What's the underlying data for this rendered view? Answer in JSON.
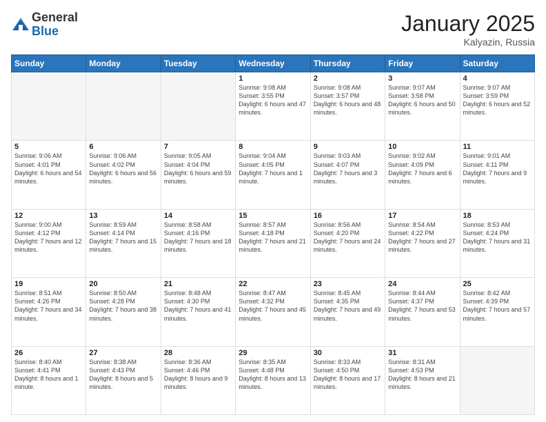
{
  "logo": {
    "general": "General",
    "blue": "Blue"
  },
  "header": {
    "month": "January 2025",
    "location": "Kalyazin, Russia"
  },
  "weekdays": [
    "Sunday",
    "Monday",
    "Tuesday",
    "Wednesday",
    "Thursday",
    "Friday",
    "Saturday"
  ],
  "weeks": [
    [
      {
        "day": "",
        "info": ""
      },
      {
        "day": "",
        "info": ""
      },
      {
        "day": "",
        "info": ""
      },
      {
        "day": "1",
        "info": "Sunrise: 9:08 AM\nSunset: 3:55 PM\nDaylight: 6 hours and 47 minutes."
      },
      {
        "day": "2",
        "info": "Sunrise: 9:08 AM\nSunset: 3:57 PM\nDaylight: 6 hours and 48 minutes."
      },
      {
        "day": "3",
        "info": "Sunrise: 9:07 AM\nSunset: 3:58 PM\nDaylight: 6 hours and 50 minutes."
      },
      {
        "day": "4",
        "info": "Sunrise: 9:07 AM\nSunset: 3:59 PM\nDaylight: 6 hours and 52 minutes."
      }
    ],
    [
      {
        "day": "5",
        "info": "Sunrise: 9:06 AM\nSunset: 4:01 PM\nDaylight: 6 hours and 54 minutes."
      },
      {
        "day": "6",
        "info": "Sunrise: 9:06 AM\nSunset: 4:02 PM\nDaylight: 6 hours and 56 minutes."
      },
      {
        "day": "7",
        "info": "Sunrise: 9:05 AM\nSunset: 4:04 PM\nDaylight: 6 hours and 59 minutes."
      },
      {
        "day": "8",
        "info": "Sunrise: 9:04 AM\nSunset: 4:05 PM\nDaylight: 7 hours and 1 minute."
      },
      {
        "day": "9",
        "info": "Sunrise: 9:03 AM\nSunset: 4:07 PM\nDaylight: 7 hours and 3 minutes."
      },
      {
        "day": "10",
        "info": "Sunrise: 9:02 AM\nSunset: 4:09 PM\nDaylight: 7 hours and 6 minutes."
      },
      {
        "day": "11",
        "info": "Sunrise: 9:01 AM\nSunset: 4:11 PM\nDaylight: 7 hours and 9 minutes."
      }
    ],
    [
      {
        "day": "12",
        "info": "Sunrise: 9:00 AM\nSunset: 4:12 PM\nDaylight: 7 hours and 12 minutes."
      },
      {
        "day": "13",
        "info": "Sunrise: 8:59 AM\nSunset: 4:14 PM\nDaylight: 7 hours and 15 minutes."
      },
      {
        "day": "14",
        "info": "Sunrise: 8:58 AM\nSunset: 4:16 PM\nDaylight: 7 hours and 18 minutes."
      },
      {
        "day": "15",
        "info": "Sunrise: 8:57 AM\nSunset: 4:18 PM\nDaylight: 7 hours and 21 minutes."
      },
      {
        "day": "16",
        "info": "Sunrise: 8:56 AM\nSunset: 4:20 PM\nDaylight: 7 hours and 24 minutes."
      },
      {
        "day": "17",
        "info": "Sunrise: 8:54 AM\nSunset: 4:22 PM\nDaylight: 7 hours and 27 minutes."
      },
      {
        "day": "18",
        "info": "Sunrise: 8:53 AM\nSunset: 4:24 PM\nDaylight: 7 hours and 31 minutes."
      }
    ],
    [
      {
        "day": "19",
        "info": "Sunrise: 8:51 AM\nSunset: 4:26 PM\nDaylight: 7 hours and 34 minutes."
      },
      {
        "day": "20",
        "info": "Sunrise: 8:50 AM\nSunset: 4:28 PM\nDaylight: 7 hours and 38 minutes."
      },
      {
        "day": "21",
        "info": "Sunrise: 8:48 AM\nSunset: 4:30 PM\nDaylight: 7 hours and 41 minutes."
      },
      {
        "day": "22",
        "info": "Sunrise: 8:47 AM\nSunset: 4:32 PM\nDaylight: 7 hours and 45 minutes."
      },
      {
        "day": "23",
        "info": "Sunrise: 8:45 AM\nSunset: 4:35 PM\nDaylight: 7 hours and 49 minutes."
      },
      {
        "day": "24",
        "info": "Sunrise: 8:44 AM\nSunset: 4:37 PM\nDaylight: 7 hours and 53 minutes."
      },
      {
        "day": "25",
        "info": "Sunrise: 8:42 AM\nSunset: 4:39 PM\nDaylight: 7 hours and 57 minutes."
      }
    ],
    [
      {
        "day": "26",
        "info": "Sunrise: 8:40 AM\nSunset: 4:41 PM\nDaylight: 8 hours and 1 minute."
      },
      {
        "day": "27",
        "info": "Sunrise: 8:38 AM\nSunset: 4:43 PM\nDaylight: 8 hours and 5 minutes."
      },
      {
        "day": "28",
        "info": "Sunrise: 8:36 AM\nSunset: 4:46 PM\nDaylight: 8 hours and 9 minutes."
      },
      {
        "day": "29",
        "info": "Sunrise: 8:35 AM\nSunset: 4:48 PM\nDaylight: 8 hours and 13 minutes."
      },
      {
        "day": "30",
        "info": "Sunrise: 8:33 AM\nSunset: 4:50 PM\nDaylight: 8 hours and 17 minutes."
      },
      {
        "day": "31",
        "info": "Sunrise: 8:31 AM\nSunset: 4:53 PM\nDaylight: 8 hours and 21 minutes."
      },
      {
        "day": "",
        "info": ""
      }
    ]
  ]
}
